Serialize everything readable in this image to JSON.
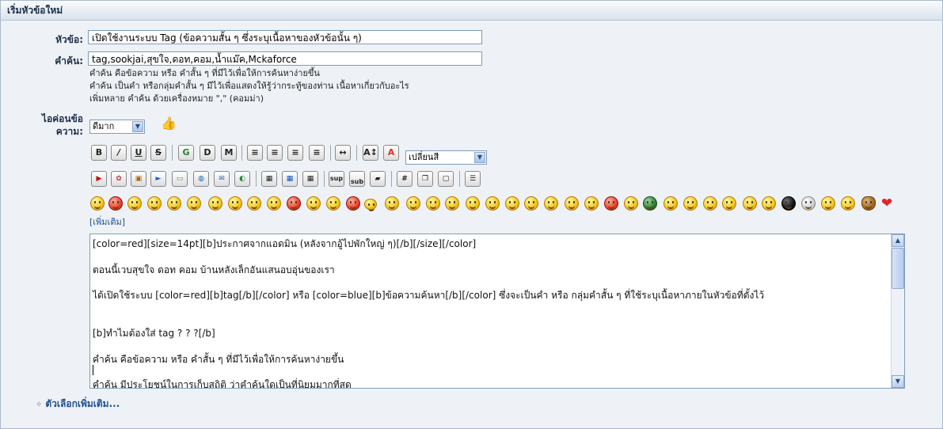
{
  "header": {
    "title": "เริ่มหัวข้อใหม่"
  },
  "form": {
    "subject_label": "หัวข้อ:",
    "subject_value": "เปิดใช้งานระบบ Tag (ข้อความสั้น ๆ ซึ่งระบุเนื้อหาของหัวข้อนั้น ๆ)",
    "tags_label": "คำค้น:",
    "tags_value": "tag,sookjai,สุขใจ,ดอท,คอม,น้ำแม๊ค,Mckaforce",
    "tags_hints": [
      "คำค้น คือข้อความ หรือ คำสั้น ๆ ที่มีไว้เพื่อให้การค้นหาง่ายขึ้น",
      "คำค้น เป็นคำ หรือกลุ่มคำสั้น ๆ มีไว้เพื่อแสดงให้รู้ว่ากระทู้ของท่าน เนื้อหาเกี่ยวกับอะไร",
      "เพิ่มหลาย คำค้น ด้วยเครื่องหมาย \",\" (คอมม่า)"
    ],
    "icon_label_line1": "ไอค่อนข้อ",
    "icon_label_line2": "ความ:",
    "icon_select_value": "ดีมาก",
    "color_select_value": "เปลี่ยนสี",
    "more_smileys": "[เพิ่มเติม]",
    "options_link": "ตัวเลือกเพิ่มเติม..."
  },
  "toolbar": {
    "row1": [
      {
        "name": "bold-button",
        "glyph": "B"
      },
      {
        "name": "italic-button",
        "glyph": "/"
      },
      {
        "name": "underline-button",
        "glyph": "U"
      },
      {
        "name": "strikethrough-button",
        "glyph": "S"
      },
      {
        "name": "glow-button",
        "glyph": "G"
      },
      {
        "name": "shadow-button",
        "glyph": "D"
      },
      {
        "name": "marquee-button",
        "glyph": "M"
      },
      {
        "name": "align-left-button",
        "glyph": "≡"
      },
      {
        "name": "align-center-button",
        "glyph": "≡"
      },
      {
        "name": "align-justify-button",
        "glyph": "≡"
      },
      {
        "name": "align-right-button",
        "glyph": "≡"
      },
      {
        "name": "horizontal-rule-button",
        "glyph": "↔"
      },
      {
        "name": "font-size-button",
        "glyph": "A↕"
      },
      {
        "name": "font-color-button",
        "glyph": "A"
      }
    ],
    "row2": [
      {
        "name": "youtube-button",
        "glyph": "▶"
      },
      {
        "name": "flash-button",
        "glyph": "✿"
      },
      {
        "name": "media-button",
        "glyph": "▣"
      },
      {
        "name": "play-button",
        "glyph": "►"
      },
      {
        "name": "image-button",
        "glyph": "▭"
      },
      {
        "name": "web-link-button",
        "glyph": "◍"
      },
      {
        "name": "email-button",
        "glyph": "✉"
      },
      {
        "name": "ftp-button",
        "glyph": "◐"
      },
      {
        "name": "table-button",
        "glyph": "▦"
      },
      {
        "name": "table-row-button",
        "glyph": "▦"
      },
      {
        "name": "table-cell-button",
        "glyph": "▦"
      },
      {
        "name": "superscript-button",
        "glyph": "sup"
      },
      {
        "name": "subscript-button",
        "glyph": "sub"
      },
      {
        "name": "teletype-button",
        "glyph": "▰"
      },
      {
        "name": "code-button",
        "glyph": "#"
      },
      {
        "name": "quote-button",
        "glyph": "❐"
      },
      {
        "name": "spoiler-button",
        "glyph": "▢"
      },
      {
        "name": "list-button",
        "glyph": "☰"
      }
    ]
  },
  "smileys": [
    "smiley",
    "cheesy",
    "wink",
    "grin",
    "cool",
    "shades",
    "angry",
    "huh",
    "kiss",
    "embarrassed",
    "red",
    "lipsrsealed",
    "undecided",
    "shocked",
    "sad",
    "sleep",
    "tongue",
    "laugh",
    "roll",
    "cry",
    "smile",
    "surprised",
    "grin2",
    "blush",
    "wow",
    "laugh2",
    "green",
    "lol",
    "cheeky",
    "cry2",
    "crazy",
    "evil",
    "angel",
    "skull",
    "zombie",
    "mellow",
    "poop",
    "heart"
  ],
  "editor": {
    "lines": [
      "[color=red][size=14pt][b]ประกาศจากแอดมิน (หลังจากอู้ไปพักใหญ่ ๆ)[/b][/size][/color]",
      "ตอนนี้เวบสุขใจ ดอท คอม บ้านหลังเล็กอันแสนอบอุ่นของเรา",
      "ได้เปิดใช้ระบบ [color=red][b]tag[/b][/color] หรือ [color=blue][b]ข้อความค้นหา[/b][/color] ซึ่งจะเป็นคำ หรือ กลุ่มคำสั้น ๆ ที่ใช้ระบุเนื้อหาภายในหัวข้อที่ตั้งไว้",
      "[b]ทำไมต้องใส่ tag ? ? ?[/b]",
      "คำค้น คือข้อความ หรือ คำสั้น ๆ ที่มีไว้เพื่อให้การค้นหาง่ายขึ้น",
      "คำค้น มีประโยชน์ในการเก็บสถิติ ว่าคำค้นใดเป็นที่นิยมมากที่สุด"
    ]
  }
}
